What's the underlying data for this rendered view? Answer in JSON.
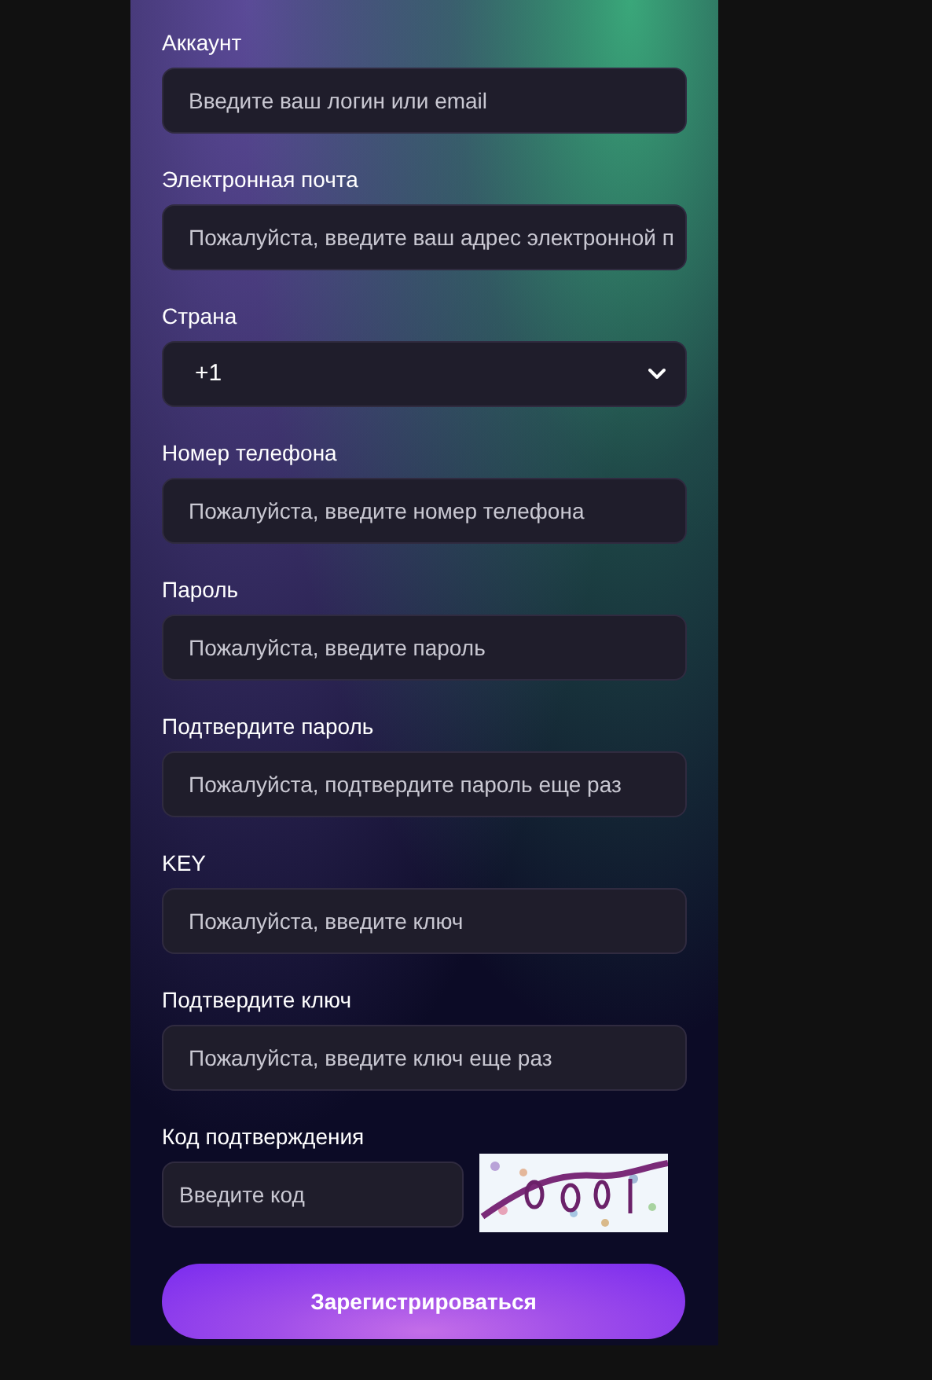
{
  "fields": [
    {
      "kind": "input",
      "label": "Аккаунт",
      "placeholder": "Введите ваш логин или email"
    },
    {
      "kind": "input",
      "label": "Электронная почта",
      "placeholder": "Пожалуйста, введите ваш адрес электронной п"
    },
    {
      "kind": "select",
      "label": "Страна",
      "value": "+1"
    },
    {
      "kind": "input",
      "label": "Номер телефона",
      "placeholder": "Пожалуйста, введите номер телефона"
    },
    {
      "kind": "input",
      "label": "Пароль",
      "placeholder": "Пожалуйста, введите пароль"
    },
    {
      "kind": "input",
      "label": "Подтвердите пароль",
      "placeholder": "Пожалуйста, подтвердите пароль еще раз"
    },
    {
      "kind": "input",
      "label": "KEY",
      "placeholder": "Пожалуйста, введите ключ"
    },
    {
      "kind": "input",
      "label": "Подтвердите ключ",
      "placeholder": "Пожалуйста, введите ключ еще раз"
    }
  ],
  "captcha": {
    "label": "Код подтверждения",
    "placeholder": "Введите код"
  },
  "submit": {
    "label": "Зарегистрироваться"
  }
}
